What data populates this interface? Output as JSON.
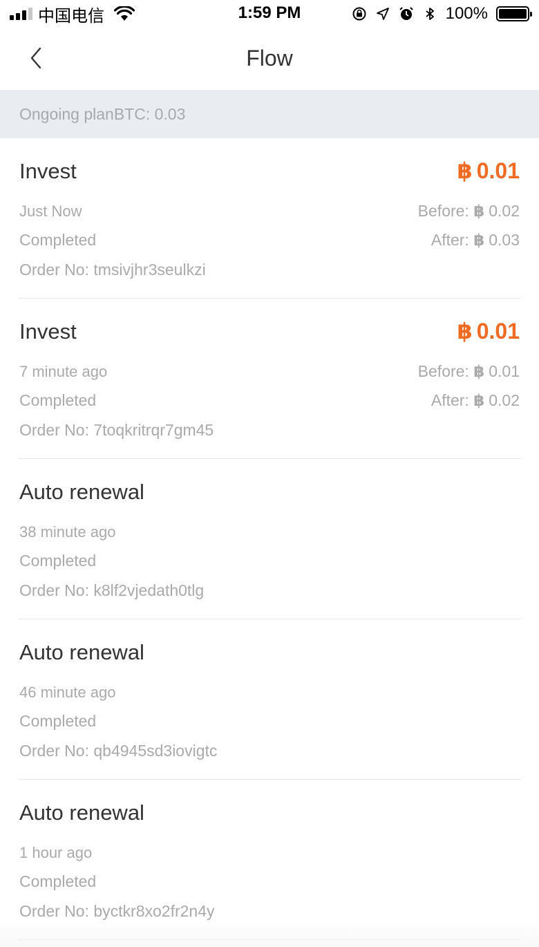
{
  "status_bar": {
    "carrier": "中国电信",
    "time": "1:59 PM",
    "battery": "100%"
  },
  "nav": {
    "title": "Flow"
  },
  "banner": {
    "text": "Ongoing planBTC: 0.03"
  },
  "currency_symbol": "฿",
  "items": [
    {
      "title": "Invest",
      "amount": "0.01",
      "time": "Just Now",
      "status": "Completed",
      "order": "Order No: tmsivjhr3seulkzi",
      "before_label": "Before:",
      "before_value": "0.02",
      "after_label": "After:",
      "after_value": "0.03"
    },
    {
      "title": "Invest",
      "amount": "0.01",
      "time": "7 minute ago",
      "status": "Completed",
      "order": "Order No: 7toqkritrqr7gm45",
      "before_label": "Before:",
      "before_value": "0.01",
      "after_label": "After:",
      "after_value": "0.02"
    },
    {
      "title": "Auto renewal",
      "time": "38 minute ago",
      "status": "Completed",
      "order": "Order No: k8lf2vjedath0tlg"
    },
    {
      "title": "Auto renewal",
      "time": "46 minute ago",
      "status": "Completed",
      "order": "Order No: qb4945sd3iovigtc"
    },
    {
      "title": "Auto renewal",
      "time": "1 hour ago",
      "status": "Completed",
      "order": "Order No: byctkr8xo2fr2n4y"
    }
  ],
  "colors": {
    "accent": "#ef6a23",
    "banner_bg": "#e9ecf1",
    "muted_text": "#aaaaaa"
  }
}
